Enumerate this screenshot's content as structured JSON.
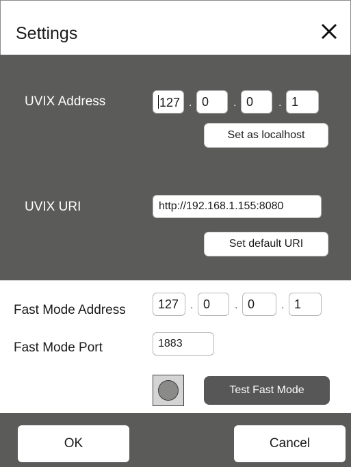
{
  "dialog": {
    "title": "Settings",
    "close_icon": "close-icon"
  },
  "uvix": {
    "address_label": "UVIX Address",
    "address": [
      "127",
      "0",
      "0",
      "1"
    ],
    "set_localhost_label": "Set as localhost",
    "uri_label": "UVIX URI",
    "uri_value": "http://192.168.1.155:8080",
    "set_default_uri_label": "Set default URI"
  },
  "fast_mode": {
    "address_label": "Fast Mode Address",
    "address": [
      "127",
      "0",
      "0",
      "1"
    ],
    "port_label": "Fast Mode Port",
    "port_value": "1883",
    "test_button_label": "Test Fast Mode",
    "status_icon": "status-led-icon"
  },
  "footer": {
    "ok_label": "OK",
    "cancel_label": "Cancel"
  },
  "colors": {
    "dark_panel": "#5b5b59",
    "dark_button": "#575757",
    "led": "#8a8a88"
  }
}
